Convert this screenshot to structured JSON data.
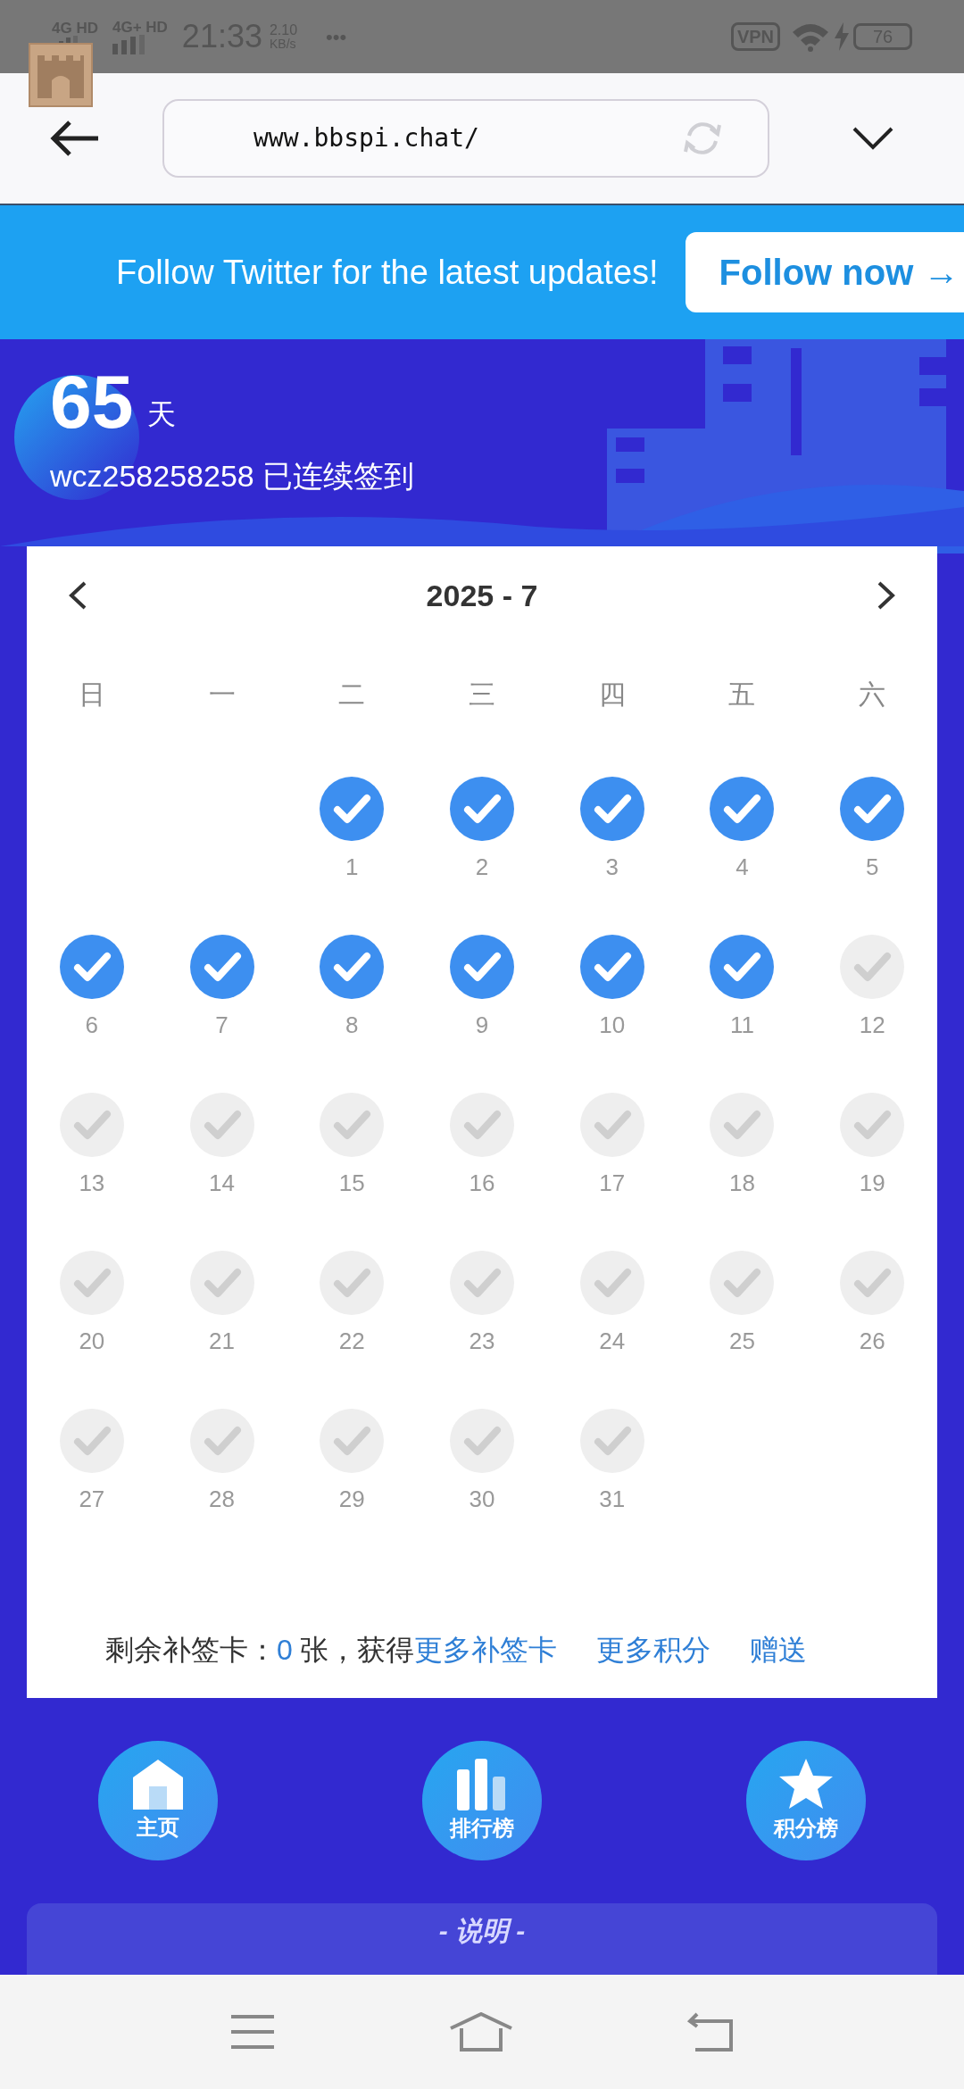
{
  "status_bar": {
    "network_1": "4G HD",
    "network_2": "4G+ HD",
    "time": "21:33",
    "speed_value": "2.10",
    "speed_unit": "KB/s",
    "more": "•••",
    "vpn": "VPN",
    "battery": "76"
  },
  "browser": {
    "url": "www.bbspi.chat/"
  },
  "banner": {
    "text": "Follow Twitter for the latest updates!",
    "button": "Follow now →"
  },
  "streak": {
    "days": "65",
    "unit": "天",
    "user_line": "wcz258258258 已连续签到"
  },
  "calendar": {
    "title": "2025 - 7",
    "weekdays": [
      "日",
      "一",
      "二",
      "三",
      "四",
      "五",
      "六"
    ],
    "weeks": [
      [
        {
          "kind": "empty"
        },
        {
          "kind": "empty"
        },
        {
          "kind": "day",
          "label": "1",
          "checked": true
        },
        {
          "kind": "day",
          "label": "2",
          "checked": true
        },
        {
          "kind": "day",
          "label": "3",
          "checked": true
        },
        {
          "kind": "day",
          "label": "4",
          "checked": true
        },
        {
          "kind": "day",
          "label": "5",
          "checked": true
        }
      ],
      [
        {
          "kind": "day",
          "label": "6",
          "checked": true
        },
        {
          "kind": "day",
          "label": "7",
          "checked": true
        },
        {
          "kind": "day",
          "label": "8",
          "checked": true
        },
        {
          "kind": "day",
          "label": "9",
          "checked": true
        },
        {
          "kind": "day",
          "label": "10",
          "checked": true
        },
        {
          "kind": "day",
          "label": "11",
          "checked": true
        },
        {
          "kind": "day",
          "label": "12",
          "checked": false
        }
      ],
      [
        {
          "kind": "day",
          "label": "13",
          "checked": false
        },
        {
          "kind": "day",
          "label": "14",
          "checked": false
        },
        {
          "kind": "day",
          "label": "15",
          "checked": false
        },
        {
          "kind": "day",
          "label": "16",
          "checked": false
        },
        {
          "kind": "day",
          "label": "17",
          "checked": false
        },
        {
          "kind": "day",
          "label": "18",
          "checked": false
        },
        {
          "kind": "day",
          "label": "19",
          "checked": false
        }
      ],
      [
        {
          "kind": "day",
          "label": "20",
          "checked": false
        },
        {
          "kind": "day",
          "label": "21",
          "checked": false
        },
        {
          "kind": "day",
          "label": "22",
          "checked": false
        },
        {
          "kind": "day",
          "label": "23",
          "checked": false
        },
        {
          "kind": "day",
          "label": "24",
          "checked": false
        },
        {
          "kind": "day",
          "label": "25",
          "checked": false
        },
        {
          "kind": "day",
          "label": "26",
          "checked": false
        }
      ],
      [
        {
          "kind": "day",
          "label": "27",
          "checked": false
        },
        {
          "kind": "day",
          "label": "28",
          "checked": false
        },
        {
          "kind": "day",
          "label": "29",
          "checked": false
        },
        {
          "kind": "day",
          "label": "30",
          "checked": false
        },
        {
          "kind": "day",
          "label": "31",
          "checked": false
        },
        {
          "kind": "empty"
        },
        {
          "kind": "empty"
        }
      ]
    ],
    "footer": {
      "prefix": "剩余补签卡：",
      "count": "0",
      "suffix": "张，获得",
      "links": [
        "更多补签卡",
        "更多积分",
        "赠送"
      ]
    }
  },
  "shortcuts": [
    {
      "kind": "home",
      "label": "主页"
    },
    {
      "kind": "ranking",
      "label": "排行榜"
    },
    {
      "kind": "points",
      "label": "积分榜"
    }
  ],
  "notes": {
    "title": "- 说明 -"
  }
}
